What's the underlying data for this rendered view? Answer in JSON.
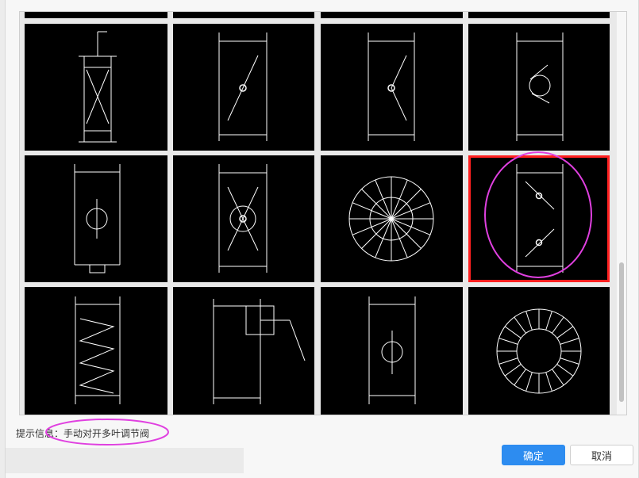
{
  "hint": {
    "label": "提示信息：",
    "value": "手动对开多叶调节阀"
  },
  "buttons": {
    "ok": "确定",
    "cancel": "取消"
  },
  "symbols": [
    {
      "id": "damper-x-with-actuator",
      "selected": false
    },
    {
      "id": "damper-single-blade-diagonal",
      "selected": false
    },
    {
      "id": "damper-bent-blade",
      "selected": false
    },
    {
      "id": "damper-spring-circle",
      "selected": false
    },
    {
      "id": "damper-circle-with-bottom-tab",
      "selected": false
    },
    {
      "id": "damper-x-circle",
      "selected": false
    },
    {
      "id": "round-radial-vaned-symbol",
      "selected": false
    },
    {
      "id": "manual-opposed-multi-blade-damper",
      "selected": true
    },
    {
      "id": "damper-zigzag",
      "selected": false
    },
    {
      "id": "damper-with-side-actuator",
      "selected": false
    },
    {
      "id": "damper-small-circle",
      "selected": false
    },
    {
      "id": "round-ring-vaned-symbol",
      "selected": false
    }
  ],
  "colors": {
    "selection": "#ff2020",
    "annotation": "#e040e0",
    "primary_button": "#2d8cf0"
  }
}
